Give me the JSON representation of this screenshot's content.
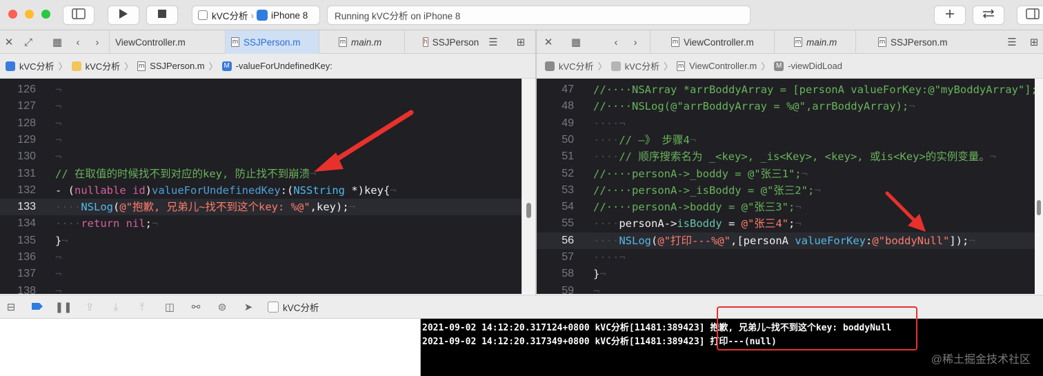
{
  "toolbar": {
    "scheme_project": "kVC分析",
    "scheme_device": "iPhone 8",
    "activity_status": "Running kVC分析 on iPhone 8"
  },
  "left_editor": {
    "tabs": [
      {
        "label": "ViewController.m",
        "icon": "m",
        "active": false
      },
      {
        "label": "SSJPerson.m",
        "icon": "m",
        "active": true
      },
      {
        "label": "main.m",
        "icon": "m",
        "active": false
      },
      {
        "label": "SSJPerson",
        "icon": "h",
        "active": false
      }
    ],
    "jumpbar": [
      "kVC分析",
      "kVC分析",
      "SSJPerson.m",
      "-valueForUndefinedKey:"
    ],
    "lines": [
      {
        "n": "126",
        "parts": [
          {
            "c": "inv",
            "t": "¬"
          }
        ]
      },
      {
        "n": "127",
        "parts": [
          {
            "c": "inv",
            "t": "¬"
          }
        ]
      },
      {
        "n": "128",
        "parts": [
          {
            "c": "inv",
            "t": "¬"
          }
        ]
      },
      {
        "n": "129",
        "parts": [
          {
            "c": "inv",
            "t": "¬"
          }
        ]
      },
      {
        "n": "130",
        "parts": [
          {
            "c": "inv",
            "t": "¬"
          }
        ]
      },
      {
        "n": "131",
        "parts": [
          {
            "c": "cm",
            "t": "// 在取值的时候找不到对应的key, 防止找不到崩溃"
          },
          {
            "c": "inv",
            "t": "¬"
          }
        ]
      },
      {
        "n": "132",
        "parts": [
          {
            "c": "tx",
            "t": "- ("
          },
          {
            "c": "kw",
            "t": "nullable"
          },
          {
            "c": "tx",
            "t": " "
          },
          {
            "c": "kw",
            "t": "id"
          },
          {
            "c": "tx",
            "t": ")"
          },
          {
            "c": "fn",
            "t": "valueForUndefinedKey"
          },
          {
            "c": "tx",
            "t": ":("
          },
          {
            "c": "ty",
            "t": "NSString"
          },
          {
            "c": "tx",
            "t": " *)key{"
          },
          {
            "c": "inv",
            "t": "¬"
          }
        ]
      },
      {
        "n": "133",
        "cur": true,
        "parts": [
          {
            "c": "inv",
            "t": "····"
          },
          {
            "c": "ty",
            "t": "NSLog"
          },
          {
            "c": "tx",
            "t": "("
          },
          {
            "c": "st",
            "t": "@\"抱歉, 兄弟儿~找不到这个key: %@\""
          },
          {
            "c": "tx",
            "t": ",key);"
          },
          {
            "c": "inv",
            "t": "¬"
          }
        ]
      },
      {
        "n": "134",
        "parts": [
          {
            "c": "inv",
            "t": "····"
          },
          {
            "c": "kw",
            "t": "return"
          },
          {
            "c": "tx",
            "t": " "
          },
          {
            "c": "kw",
            "t": "nil"
          },
          {
            "c": "tx",
            "t": ";"
          },
          {
            "c": "inv",
            "t": "¬"
          }
        ]
      },
      {
        "n": "135",
        "parts": [
          {
            "c": "tx",
            "t": "}"
          },
          {
            "c": "inv",
            "t": "¬"
          }
        ]
      },
      {
        "n": "136",
        "parts": [
          {
            "c": "inv",
            "t": "¬"
          }
        ]
      },
      {
        "n": "137",
        "parts": [
          {
            "c": "inv",
            "t": "¬"
          }
        ]
      },
      {
        "n": "138",
        "parts": [
          {
            "c": "inv",
            "t": "¬"
          }
        ]
      }
    ]
  },
  "right_editor": {
    "tabs": [
      {
        "label": "ViewController.m",
        "icon": "m",
        "active": false
      },
      {
        "label": "main.m",
        "icon": "m",
        "active": false
      },
      {
        "label": "SSJPerson.m",
        "icon": "m",
        "active": false
      }
    ],
    "jumpbar": [
      "kVC分析",
      "kVC分析",
      "ViewController.m",
      "-viewDidLoad"
    ],
    "lines": [
      {
        "n": "47",
        "parts": [
          {
            "c": "cm",
            "t": "//····NSArray *arrBoddyArray = [personA valueForKey:@\"myBoddyArray\"];"
          },
          {
            "c": "inv",
            "t": "¬"
          }
        ]
      },
      {
        "n": "48",
        "parts": [
          {
            "c": "cm",
            "t": "//····NSLog(@\"arrBoddyArray = %@\",arrBoddyArray);"
          },
          {
            "c": "inv",
            "t": "¬"
          }
        ]
      },
      {
        "n": "49",
        "parts": [
          {
            "c": "inv",
            "t": "····¬"
          }
        ]
      },
      {
        "n": "50",
        "parts": [
          {
            "c": "inv",
            "t": "····"
          },
          {
            "c": "cm",
            "t": "// —》 步骤4"
          },
          {
            "c": "inv",
            "t": "¬"
          }
        ]
      },
      {
        "n": "51",
        "parts": [
          {
            "c": "inv",
            "t": "····"
          },
          {
            "c": "cm",
            "t": "// 顺序搜索名为 _<key>, _is<Key>, <key>, 或is<Key>的实例变量。"
          },
          {
            "c": "inv",
            "t": "¬"
          }
        ]
      },
      {
        "n": "52",
        "parts": [
          {
            "c": "cm",
            "t": "//····personA->_boddy = @\"张三1\";"
          },
          {
            "c": "inv",
            "t": "¬"
          }
        ]
      },
      {
        "n": "53",
        "parts": [
          {
            "c": "cm",
            "t": "//····personA->_isBoddy = @\"张三2\";"
          },
          {
            "c": "inv",
            "t": "¬"
          }
        ]
      },
      {
        "n": "54",
        "parts": [
          {
            "c": "cm",
            "t": "//····personA->boddy = @\"张三3\";"
          },
          {
            "c": "inv",
            "t": "¬"
          }
        ]
      },
      {
        "n": "55",
        "parts": [
          {
            "c": "inv",
            "t": "····"
          },
          {
            "c": "tx",
            "t": "personA->"
          },
          {
            "c": "prop",
            "t": "isBoddy"
          },
          {
            "c": "tx",
            "t": " = "
          },
          {
            "c": "st",
            "t": "@\"张三4\""
          },
          {
            "c": "tx",
            "t": ";"
          },
          {
            "c": "inv",
            "t": "¬"
          }
        ]
      },
      {
        "n": "56",
        "cur": true,
        "parts": [
          {
            "c": "inv",
            "t": "····"
          },
          {
            "c": "ty",
            "t": "NSLog"
          },
          {
            "c": "tx",
            "t": "("
          },
          {
            "c": "st",
            "t": "@\"打印---%@\""
          },
          {
            "c": "tx",
            "t": ",[personA "
          },
          {
            "c": "ty",
            "t": "valueForKey"
          },
          {
            "c": "tx",
            "t": ":"
          },
          {
            "c": "st",
            "t": "@\"boddyNull\""
          },
          {
            "c": "tx",
            "t": "]);"
          },
          {
            "c": "inv",
            "t": "¬"
          }
        ]
      },
      {
        "n": "57",
        "parts": [
          {
            "c": "inv",
            "t": "····¬"
          }
        ]
      },
      {
        "n": "58",
        "parts": [
          {
            "c": "tx",
            "t": "}"
          },
          {
            "c": "inv",
            "t": "¬"
          }
        ]
      },
      {
        "n": "59",
        "parts": [
          {
            "c": "inv",
            "t": "¬"
          }
        ]
      }
    ]
  },
  "debugbar": {
    "target_label": "kVC分析"
  },
  "console": {
    "lines": [
      "2021-09-02 14:12:20.317124+0800 kVC分析[11481:389423] 抱歉, 兄弟儿~找不到这个key: boddyNull",
      "2021-09-02 14:12:20.317349+0800 kVC分析[11481:389423] 打印---(null)"
    ],
    "watermark": "@稀土掘金技术社区"
  },
  "colors": {
    "annotation_red": "#e8312c",
    "editor_bg": "#1f1f24",
    "active_tab": "#cfe0f5"
  }
}
